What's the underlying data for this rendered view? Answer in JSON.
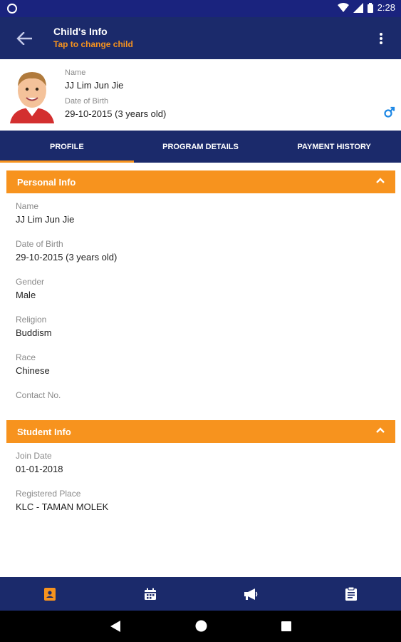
{
  "status_bar": {
    "time": "2:28"
  },
  "app_bar": {
    "title": "Child's Info",
    "subtitle": "Tap to change child",
    "back_icon": "arrow-left-icon",
    "menu_icon": "more-vert-icon"
  },
  "child": {
    "name_label": "Name",
    "name": "JJ Lim Jun Jie",
    "dob_label": "Date of Birth",
    "dob": "29-10-2015 (3 years old)",
    "gender_icon": "male-icon"
  },
  "tabs": [
    {
      "label": "PROFILE",
      "active": true
    },
    {
      "label": "PROGRAM DETAILS",
      "active": false
    },
    {
      "label": "PAYMENT HISTORY",
      "active": false
    }
  ],
  "personal_info": {
    "title": "Personal Info",
    "fields": [
      {
        "label": "Name",
        "value": "JJ Lim Jun Jie"
      },
      {
        "label": "Date of Birth",
        "value": "29-10-2015 (3 years old)"
      },
      {
        "label": "Gender",
        "value": "Male"
      },
      {
        "label": "Religion",
        "value": "Buddism"
      },
      {
        "label": "Race",
        "value": "Chinese"
      },
      {
        "label": "Contact No.",
        "value": ""
      }
    ]
  },
  "student_info": {
    "title": "Student Info",
    "fields": [
      {
        "label": "Join Date",
        "value": "01-01-2018"
      },
      {
        "label": "Registered Place",
        "value": "KLC - TAMAN MOLEK"
      }
    ]
  },
  "bottom_nav": [
    {
      "icon": "profile-card-icon",
      "active": true
    },
    {
      "icon": "calendar-icon",
      "active": false
    },
    {
      "icon": "megaphone-icon",
      "active": false
    },
    {
      "icon": "clipboard-icon",
      "active": false
    }
  ],
  "colors": {
    "primary": "#1b2a6b",
    "accent": "#f7931e",
    "male_blue": "#1e88e5"
  }
}
